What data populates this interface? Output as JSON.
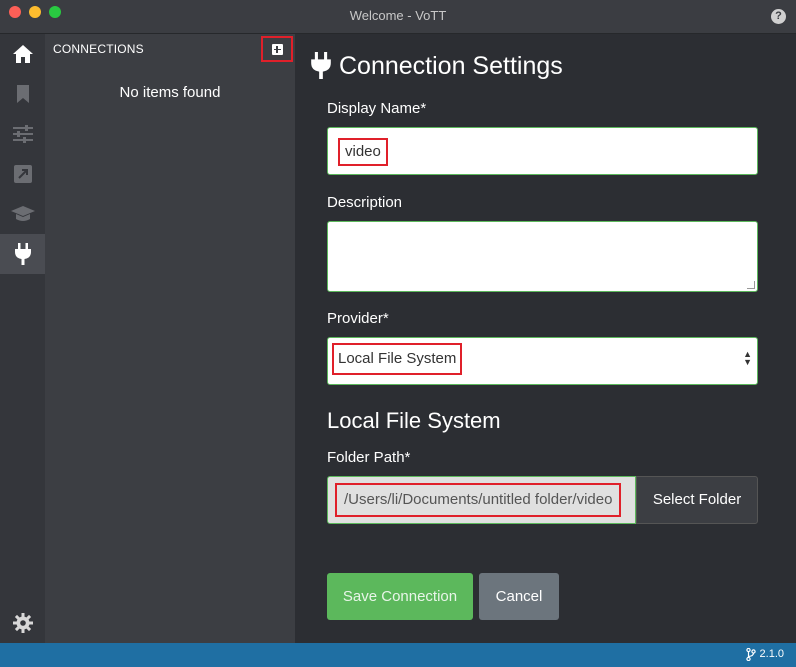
{
  "window": {
    "title": "Welcome - VoTT",
    "help_glyph": "?"
  },
  "rail": {
    "items": [
      {
        "icon": "home-icon"
      },
      {
        "icon": "bookmark-icon"
      },
      {
        "icon": "sliders-icon"
      },
      {
        "icon": "export-icon"
      },
      {
        "icon": "graduation-cap-icon"
      },
      {
        "icon": "plug-icon",
        "active": true
      }
    ],
    "settings_icon": "gear-icon"
  },
  "connections_panel": {
    "header": "CONNECTIONS",
    "empty_message": "No items found"
  },
  "form": {
    "title": "Connection Settings",
    "display_name_label": "Display Name*",
    "display_name_value": "video",
    "description_label": "Description",
    "description_value": "",
    "provider_label": "Provider*",
    "provider_value": "Local File System",
    "section_title": "Local File System",
    "folder_path_label": "Folder Path*",
    "folder_path_value": "/Users/li/Documents/untitled folder/video",
    "select_folder_label": "Select Folder",
    "save_label": "Save Connection",
    "cancel_label": "Cancel"
  },
  "statusbar": {
    "version": "2.1.0"
  },
  "colors": {
    "accent_green": "#5cb85c",
    "statusbar_blue": "#1f6fa3",
    "highlight_red": "#e0202a"
  }
}
